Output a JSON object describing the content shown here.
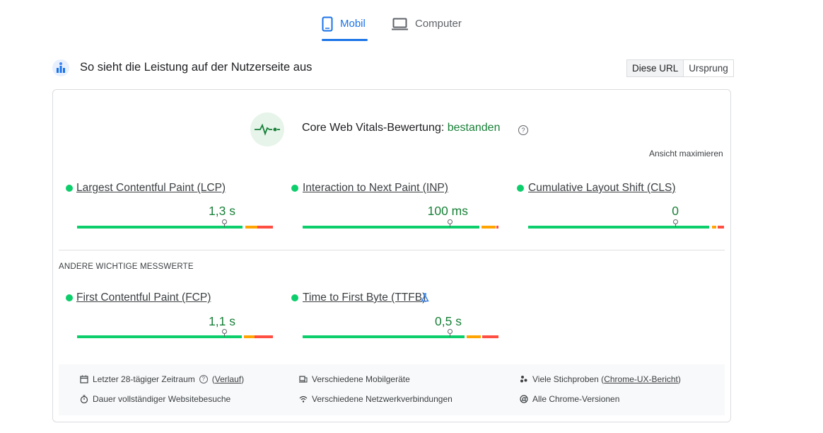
{
  "tabs": [
    {
      "label": "Mobil",
      "active": true,
      "icon": "smartphone-icon"
    },
    {
      "label": "Computer",
      "active": false,
      "icon": "laptop-icon"
    }
  ],
  "section": {
    "title": "So sieht die Leistung auf der Nutzerseite aus",
    "toggle": [
      "Diese URL",
      "Ursprung"
    ]
  },
  "assessment": {
    "label": "Core Web Vitals-Bewertung:",
    "status": "bestanden",
    "maximize": "Ansicht maximieren"
  },
  "core_metrics": [
    {
      "name": "Largest Contentful Paint (LCP)",
      "value": "1,3 s",
      "status": "good"
    },
    {
      "name": "Interaction to Next Paint (INP)",
      "value": "100 ms",
      "status": "good"
    },
    {
      "name": "Cumulative Layout Shift (CLS)",
      "value": "0",
      "status": "good"
    }
  ],
  "other_title": "ANDERE WICHTIGE MESSWERTE",
  "other_metrics": [
    {
      "name": "First Contentful Paint (FCP)",
      "value": "1,1 s",
      "status": "good"
    },
    {
      "name": "Time to First Byte (TTFB)",
      "value": "0,5 s",
      "status": "good",
      "experimental": true
    }
  ],
  "footer": {
    "period": "Letzter 28-tägiger Zeitraum",
    "history_link": "Verlauf",
    "duration": "Dauer vollständiger Websitebesuche",
    "devices": "Verschiedene Mobilgeräte",
    "network": "Verschiedene Netzwerkverbindungen",
    "samples_prefix": "Viele Stichproben (",
    "samples_link": "Chrome-UX-Bericht",
    "samples_suffix": ")",
    "versions": "Alle Chrome-Versionen"
  },
  "colors": {
    "accent": "#1a73e8",
    "good": "#0cce6b",
    "average": "#ffa400",
    "poor": "#ff4e42",
    "good_text": "#188038"
  }
}
